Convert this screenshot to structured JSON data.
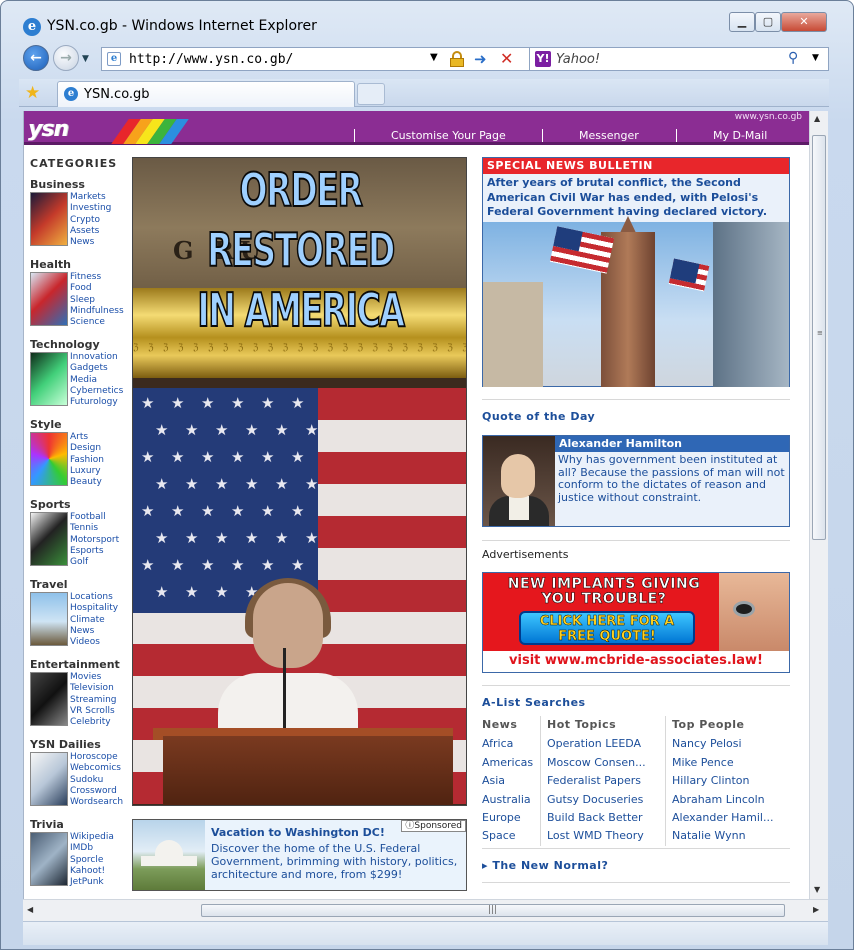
{
  "browser": {
    "window_title": "YSN.co.gb - Windows Internet Explorer",
    "address": "http://www.ysn.co.gb/",
    "search_placeholder": "Yahoo!",
    "tab_label": "YSN.co.gb",
    "icons": [
      "ie-logo-icon",
      "back-icon",
      "forward-icon",
      "lock-icon",
      "go-icon",
      "stop-icon",
      "yahoo-icon",
      "search-icon",
      "favorites-star-icon"
    ]
  },
  "site": {
    "url_text": "www.ysn.co.gb",
    "logo": "ysn",
    "nav": [
      "Customise Your Page",
      "Messenger",
      "My D-Mail"
    ]
  },
  "categories": {
    "heading": "CATEGORIES",
    "groups": [
      {
        "title": "Business",
        "links": [
          "Markets",
          "Investing",
          "Crypto",
          "Assets",
          "News"
        ]
      },
      {
        "title": "Health",
        "links": [
          "Fitness",
          "Food",
          "Sleep",
          "Mindfulness",
          "Science"
        ]
      },
      {
        "title": "Technology",
        "links": [
          "Innovation",
          "Gadgets",
          "Media",
          "Cybernetics",
          "Futurology"
        ]
      },
      {
        "title": "Style",
        "links": [
          "Arts",
          "Design",
          "Fashion",
          "Luxury",
          "Beauty"
        ]
      },
      {
        "title": "Sports",
        "links": [
          "Football",
          "Tennis",
          "Motorsport",
          "Esports",
          "Golf"
        ]
      },
      {
        "title": "Travel",
        "links": [
          "Locations",
          "Hospitality",
          "Climate",
          "News",
          "Videos"
        ]
      },
      {
        "title": "Entertainment",
        "links": [
          "Movies",
          "Television",
          "Streaming",
          "VR Scrolls",
          "Celebrity"
        ]
      },
      {
        "title": "YSN Dailies",
        "links": [
          "Horoscope",
          "Webcomics",
          "Sudoku",
          "Crossword",
          "Wordsearch"
        ]
      },
      {
        "title": "Trivia",
        "links": [
          "Wikipedia",
          "IMDb",
          "Sporcle",
          "Kahoot!",
          "JetPunk"
        ]
      }
    ]
  },
  "hero": {
    "line1": "ORDER RESTORED",
    "line2": "IN AMERICA",
    "wall_text": "G      RU"
  },
  "vacation_ad": {
    "title": "Vacation to Washington DC!",
    "body": "Discover the home of the U.S. Federal Government, brimming with history, politics, architecture and more, from $299!",
    "badge": "ⓘSponsored"
  },
  "bulletin": {
    "heading": "SPECIAL NEWS BULLETIN",
    "text": "After years of brutal conflict, the Second American Civil War has ended,  with Pelosi's Federal Government having declared victory."
  },
  "quote": {
    "heading": "Quote of the Day",
    "author": "Alexander Hamilton",
    "text": "Why has government been instituted at all? Because the passions of man will not conform to the dictates of reason and justice without constraint."
  },
  "ads": {
    "heading": "Advertisements",
    "law_headline": "NEW IMPLANTS GIVING YOU TROUBLE?",
    "law_button": "CLICK HERE FOR A FREE QUOTE!",
    "law_url": "visit www.mcbride-associates.law!"
  },
  "alist": {
    "heading": "A-List Searches",
    "columns": [
      {
        "title": "News",
        "items": [
          "Africa",
          "Americas",
          "Asia",
          "Australia",
          "Europe",
          "Space"
        ]
      },
      {
        "title": "Hot Topics",
        "items": [
          "Operation LEEDA",
          "Moscow Consen...",
          "Federalist Papers",
          "Gutsy Docuseries",
          "Build Back Better",
          "Lost WMD Theory"
        ]
      },
      {
        "title": "Top People",
        "items": [
          "Nancy Pelosi",
          "Mike Pence",
          "Hillary Clinton",
          "Abraham Lincoln",
          "Alexander Hamil...",
          "Natalie Wynn"
        ]
      }
    ]
  },
  "new_normal": "▸ The New Normal?"
}
